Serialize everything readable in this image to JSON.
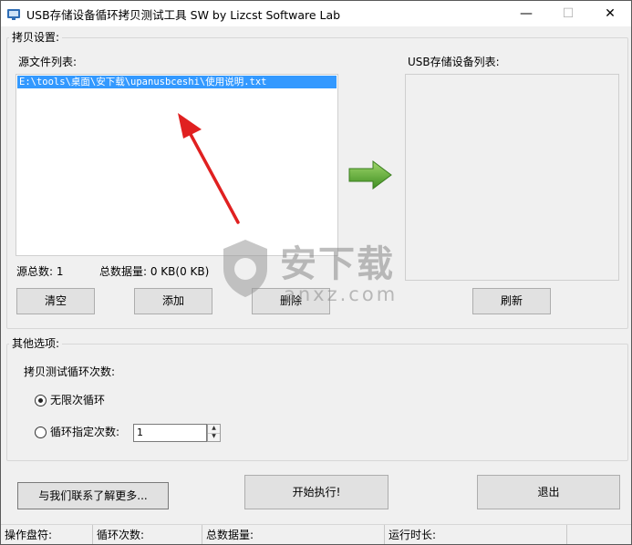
{
  "window": {
    "title": "USB存储设备循环拷贝测试工具 SW  by Lizcst Software Lab",
    "controls": {
      "minimize": "—",
      "maximize": "☐",
      "close": "✕"
    }
  },
  "copy_settings": {
    "group_label": "拷贝设置:",
    "source_list_label": "源文件列表:",
    "source_files": [
      "E:\\tools\\桌面\\安下载\\upanusbceshi\\使用说明.txt"
    ],
    "source_count_label": "源总数: 1",
    "total_data_label": "总数据量: 0 KB(0 KB)",
    "clear_button": "清空",
    "add_button": "添加",
    "delete_button": "删除",
    "usb_list_label": "USB存储设备列表:",
    "refresh_button": "刷新"
  },
  "other_options": {
    "group_label": "其他选项:",
    "loop_count_label": "拷贝测试循环次数:",
    "unlimited_radio": "无限次循环",
    "unlimited_selected": true,
    "specified_radio": "循环指定次数:",
    "specified_count": "1"
  },
  "actions": {
    "contact_button": "与我们联系了解更多...",
    "start_button": "开始执行!",
    "exit_button": "退出"
  },
  "status_bar": {
    "drive": "操作盘符:",
    "loops": "循环次数:",
    "total_data": "总数据量:",
    "run_time": "运行时长:"
  },
  "watermark": {
    "text": "安下载",
    "subtext": "anxz.com"
  },
  "colors": {
    "selection": "#3399ff",
    "arrow_green": "#5aa832",
    "annotation_red": "#e02020"
  }
}
